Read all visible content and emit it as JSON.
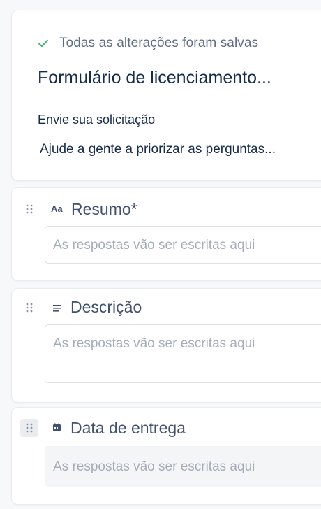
{
  "header": {
    "saved_status": "Todas as alterações foram salvas",
    "title": "Formulário de licenciamento...",
    "subtitle": "Envie sua solicitação",
    "description": "Ajude a gente a priorizar as perguntas..."
  },
  "fields": [
    {
      "type_icon_text": "Aa",
      "label": "Resumo*",
      "placeholder": "As respostas vão ser escritas aqui"
    },
    {
      "type_icon_text": "≡",
      "label": "Descrição",
      "placeholder": "As respostas vão ser escritas aqui"
    },
    {
      "type_icon_text": "",
      "label": "Data de entrega",
      "placeholder": "As respostas vão ser escritas aqui"
    }
  ],
  "icons": {
    "saved": "check-icon",
    "drag": "drag-handle-icon",
    "short_text": "short-text-icon",
    "paragraph": "paragraph-icon",
    "date": "calendar-icon"
  },
  "colors": {
    "check": "#36b37e",
    "label": "#42526e",
    "placeholder": "#a5adba"
  }
}
